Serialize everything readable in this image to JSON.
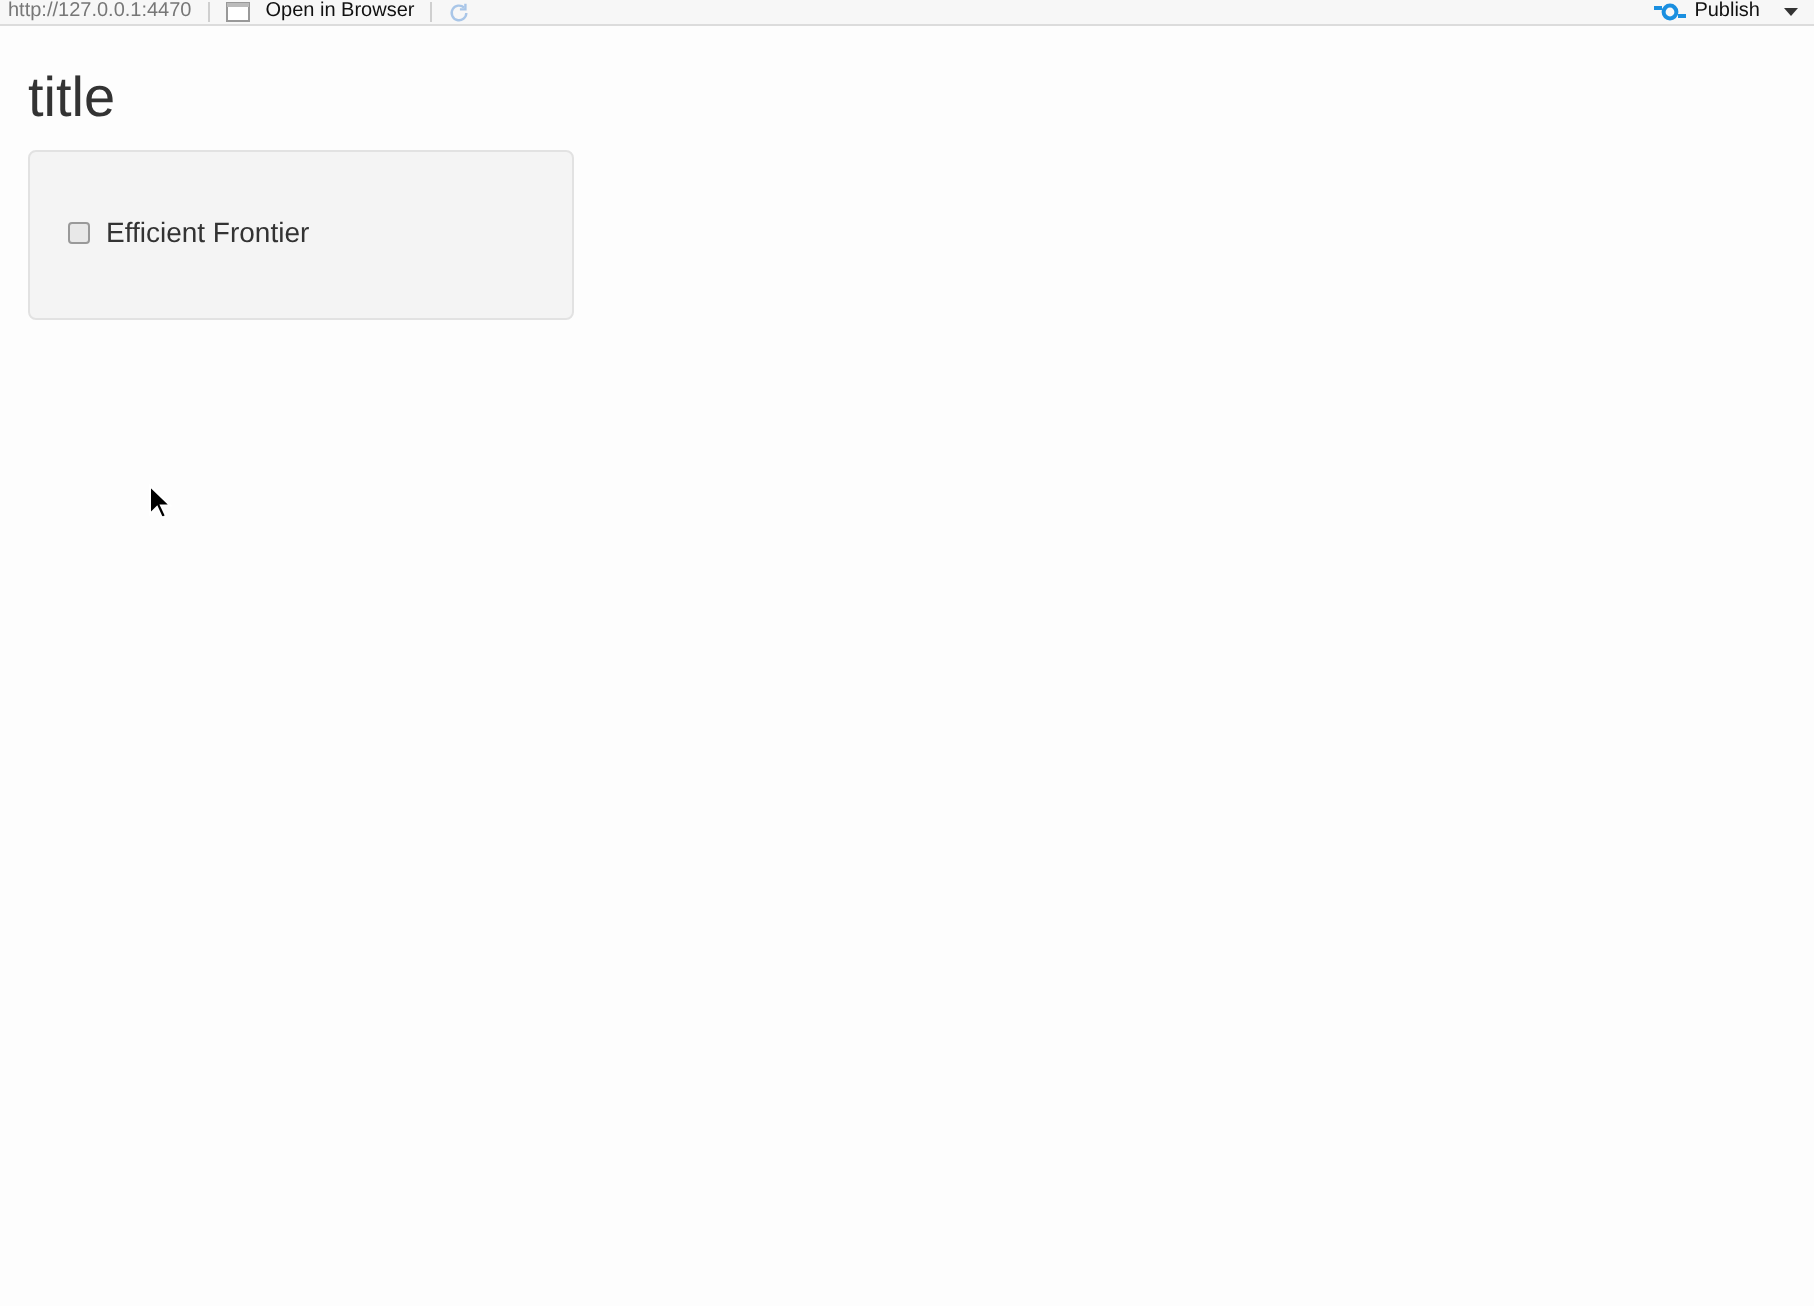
{
  "toolbar": {
    "url": "http://127.0.0.1:4470",
    "open_button": "Open in Browser",
    "publish_button": "Publish"
  },
  "title": "title",
  "panel": {
    "checkboxes": [
      {
        "label": "Efficient Frontier",
        "checked": false
      }
    ]
  }
}
